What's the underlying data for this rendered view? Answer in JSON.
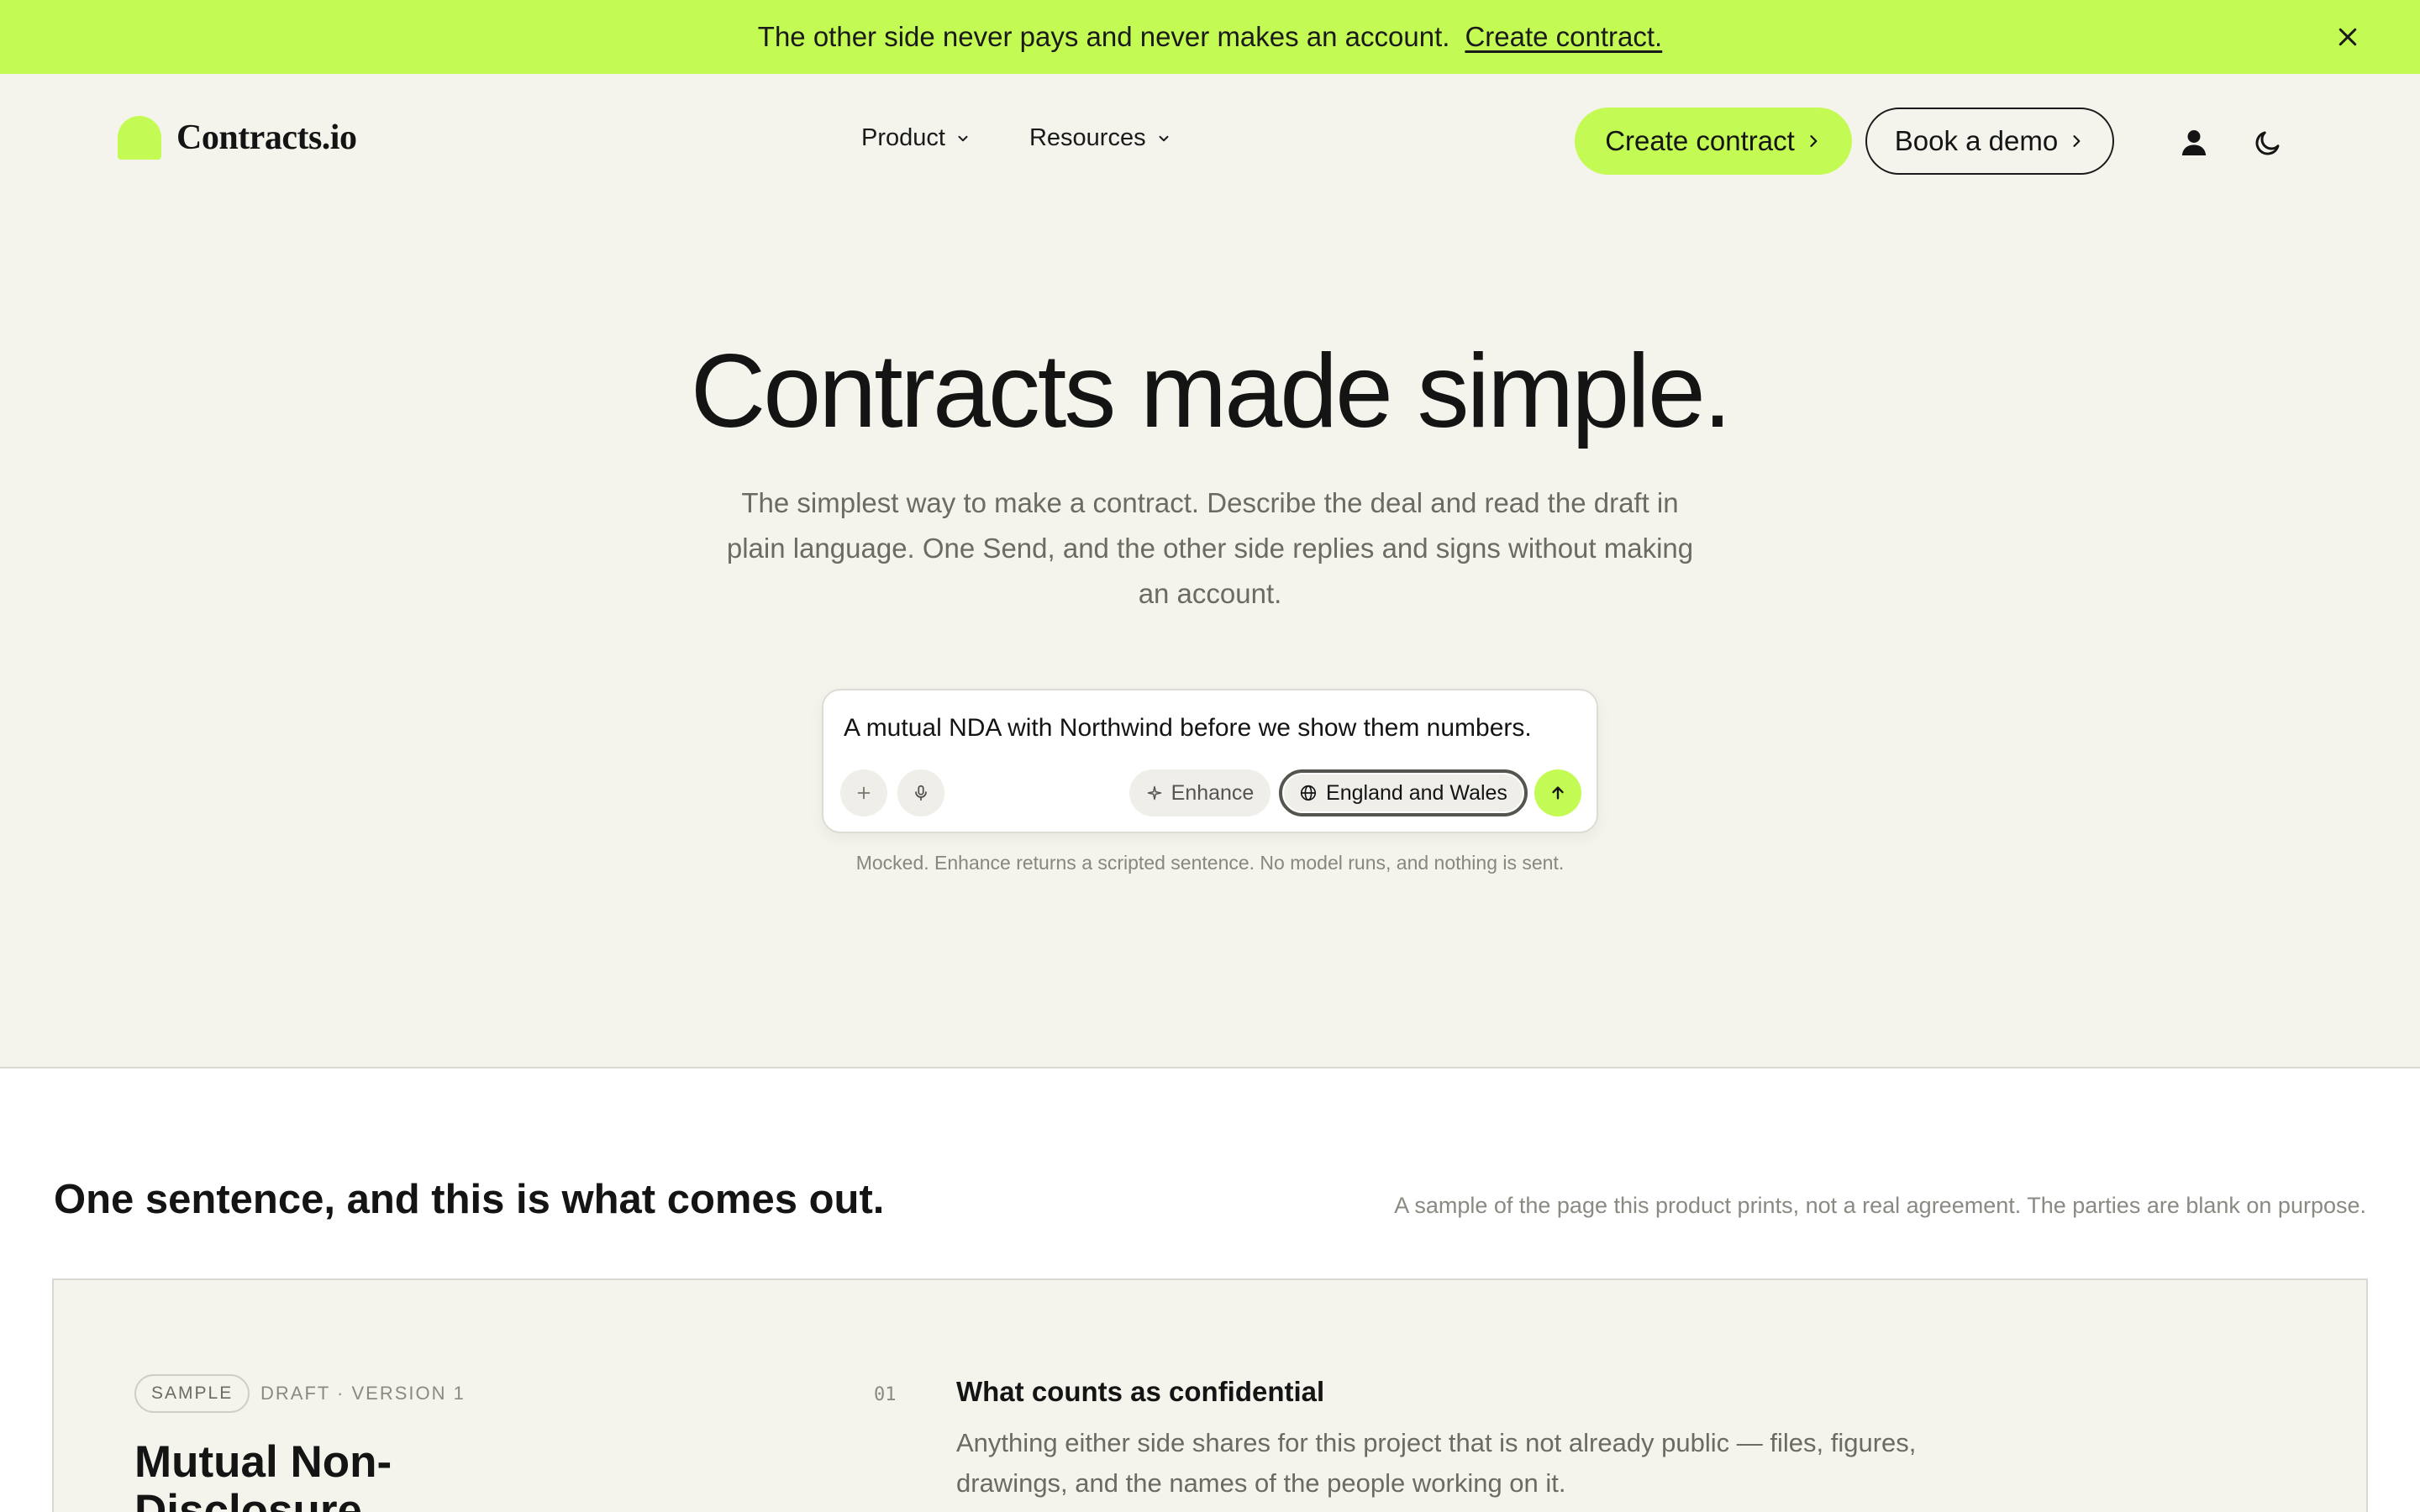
{
  "announcement": {
    "text": "The other side never pays and never makes an account.",
    "link": "Create contract.",
    "close_icon": "close-icon"
  },
  "header": {
    "logo_text": "Contracts.io",
    "nav": [
      {
        "label": "Product"
      },
      {
        "label": "Resources"
      }
    ],
    "create_button": "Create contract",
    "demo_button": "Book a demo",
    "account_icon": "user-icon",
    "theme_icon": "moon-icon"
  },
  "hero": {
    "title": "Contracts made simple.",
    "subtitle": "The simplest way to make a contract. Describe the deal and read the draft in plain language. One Send, and the other side replies and signs without making an account."
  },
  "prompt": {
    "value": "A mutual NDA with Northwind before we show them numbers.",
    "enhance_label": "Enhance",
    "region_label": "England and Wales",
    "note": "Mocked. Enhance returns a scripted sentence. No model runs, and nothing is sent."
  },
  "sample": {
    "heading": "One sentence, and this is what comes out.",
    "caption": "A sample of the page this product prints, not a real agreement. The parties are blank on purpose.",
    "badge": "SAMPLE",
    "draft_label": "DRAFT · VERSION 1",
    "doc_title": "Mutual Non-Disclosure Agreement",
    "clause": {
      "number": "01",
      "title": "What counts as confidential",
      "body": "Anything either side shares for this project that is not already public — files, figures, drawings, and the names of the people working on it."
    }
  },
  "colors": {
    "accent": "#c3fb54",
    "background": "#f4f3ec",
    "text": "#141414",
    "muted": "#6b6a63"
  }
}
